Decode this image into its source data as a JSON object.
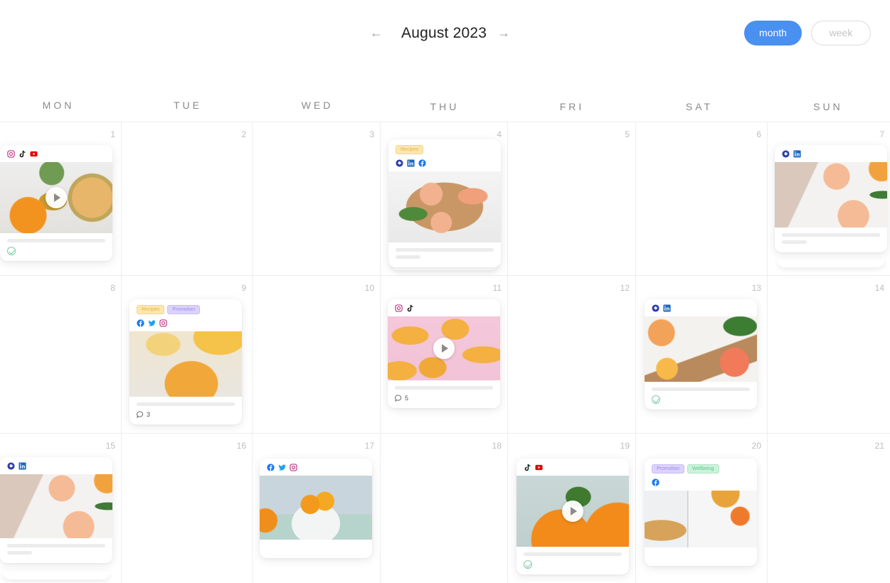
{
  "header": {
    "title": "August 2023",
    "prev_icon": "arrow-left-icon",
    "next_icon": "arrow-right-icon",
    "prev_glyph": "←",
    "next_glyph": "→",
    "view_toggle": {
      "month_label": "month",
      "week_label": "week",
      "active": "month"
    }
  },
  "colors": {
    "accent": "#4a90f0",
    "check": "#7cc9a7"
  },
  "weekdays": [
    "MON",
    "TUE",
    "WED",
    "THU",
    "FRI",
    "SAT",
    "SUN"
  ],
  "weeks": [
    [
      "1",
      "2",
      "3",
      "4",
      "5",
      "6",
      "7"
    ],
    [
      "8",
      "9",
      "10",
      "11",
      "12",
      "13",
      "14"
    ],
    [
      "15",
      "16",
      "17",
      "18",
      "19",
      "20",
      "21"
    ]
  ],
  "posts": [
    {
      "day": "1",
      "tags": [],
      "networks": [
        "instagram",
        "tiktok",
        "youtube"
      ],
      "video": true,
      "image": "pineapple and melon smoothie",
      "status": "approved",
      "comments": null,
      "stacked": false
    },
    {
      "day": "4",
      "tags": [
        "Recipes"
      ],
      "networks": [
        "google",
        "linkedin",
        "facebook"
      ],
      "video": false,
      "image": "grapefruit drinks on wooden board",
      "status": null,
      "comments": null,
      "stacked": true
    },
    {
      "day": "7",
      "tags": [],
      "networks": [
        "google",
        "linkedin"
      ],
      "video": false,
      "image": "grapefruit drinks with napkin",
      "status": null,
      "comments": null,
      "stacked": true
    },
    {
      "day": "9",
      "tags": [
        "Recipes",
        "Promotion"
      ],
      "networks": [
        "facebook",
        "twitter",
        "instagram"
      ],
      "video": false,
      "image": "mango smoothie jar with straw",
      "status": null,
      "comments": "3",
      "stacked": false
    },
    {
      "day": "11",
      "tags": [],
      "networks": [
        "instagram",
        "tiktok"
      ],
      "video": true,
      "image": "dried mango on pink background",
      "status": null,
      "comments": "5",
      "stacked": false
    },
    {
      "day": "13",
      "tags": [],
      "networks": [
        "google",
        "linkedin"
      ],
      "video": false,
      "image": "sliced citrus on cutting board",
      "status": "approved",
      "comments": null,
      "stacked": false
    },
    {
      "day": "15",
      "tags": [],
      "networks": [
        "google",
        "linkedin"
      ],
      "video": false,
      "image": "grapefruit drinks with napkin",
      "status": null,
      "comments": null,
      "stacked": true
    },
    {
      "day": "17",
      "tags": [],
      "networks": [
        "facebook",
        "twitter",
        "instagram"
      ],
      "video": false,
      "image": "oranges on cake stand",
      "status": null,
      "comments": null,
      "stacked": false
    },
    {
      "day": "19",
      "tags": [],
      "networks": [
        "tiktok",
        "youtube"
      ],
      "video": true,
      "image": "oranges with leaves",
      "status": "approved",
      "comments": null,
      "stacked": false
    },
    {
      "day": "20",
      "tags": [
        "Promotion",
        "Wellbeing"
      ],
      "networks": [
        "facebook"
      ],
      "video": false,
      "image": "magazine with tea and orange",
      "status": null,
      "comments": null,
      "stacked": false
    }
  ]
}
